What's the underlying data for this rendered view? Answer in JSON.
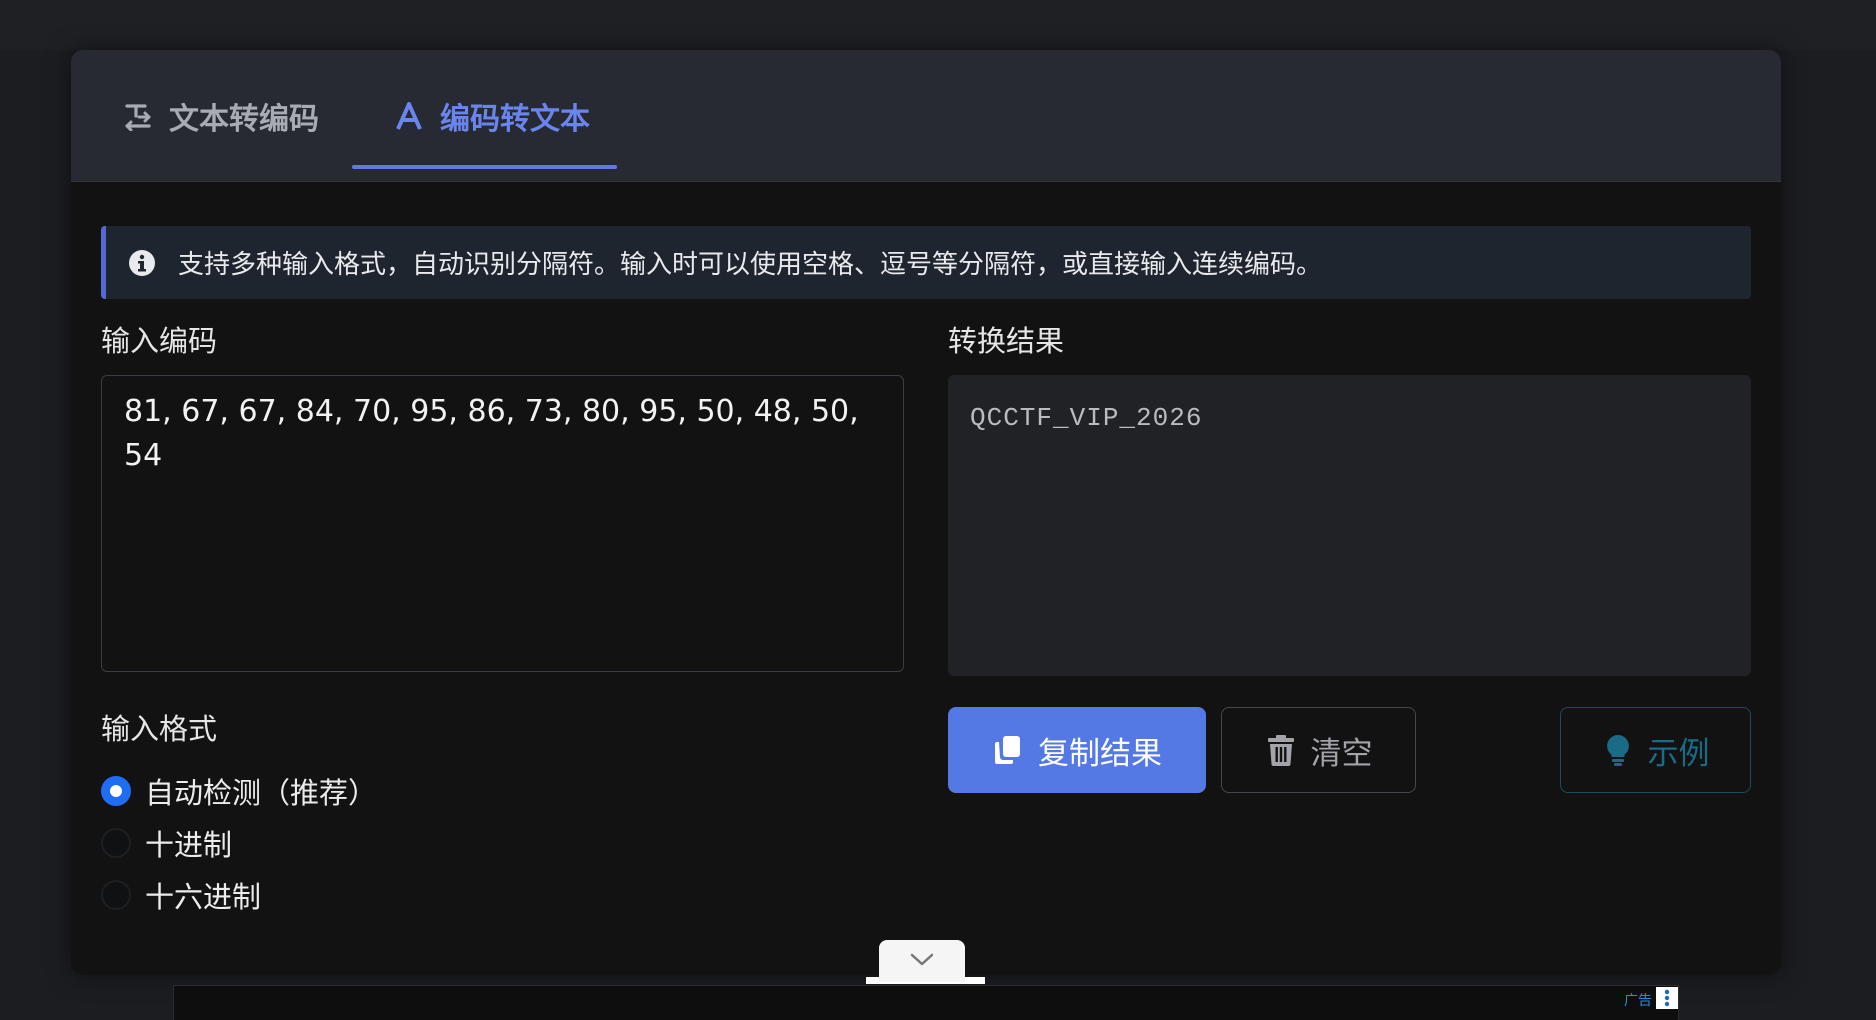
{
  "tabs": [
    {
      "label": "文本转编码",
      "icon": "text-convert-icon",
      "active": false
    },
    {
      "label": "编码转文本",
      "icon": "letter-a-icon",
      "active": true
    }
  ],
  "info": {
    "icon": "info-circle-icon",
    "text": "支持多种输入格式，自动识别分隔符。输入时可以使用空格、逗号等分隔符，或直接输入连续编码。"
  },
  "input": {
    "label": "输入编码",
    "value": "81, 67, 67, 84, 70, 95, 86, 73, 80, 95, 50, 48, 50, 54"
  },
  "result": {
    "label": "转换结果",
    "value": "QCCTF_VIP_2026"
  },
  "format": {
    "label": "输入格式",
    "options": [
      {
        "label": "自动检测（推荐）",
        "selected": true
      },
      {
        "label": "十进制",
        "selected": false
      },
      {
        "label": "十六进制",
        "selected": false
      }
    ]
  },
  "buttons": {
    "copy": {
      "label": "复制结果",
      "icon": "copy-icon"
    },
    "clear": {
      "label": "清空",
      "icon": "trash-icon"
    },
    "example": {
      "label": "示例",
      "icon": "lightbulb-icon"
    }
  },
  "ad": {
    "label": "广告"
  },
  "colors": {
    "accent": "#5579e4",
    "active_tab": "#6b85ee",
    "example": "#1a6c86"
  }
}
